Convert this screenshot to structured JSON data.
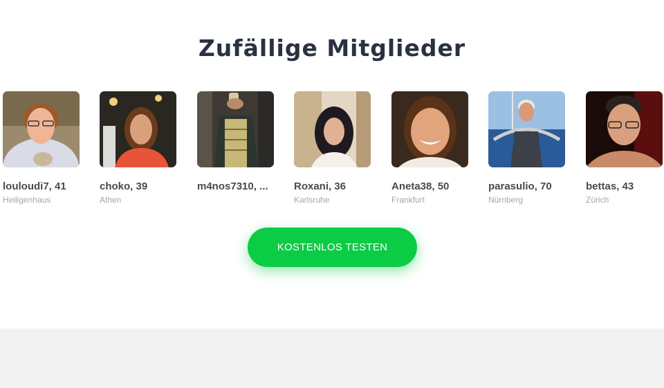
{
  "heading": "Zufällige Mitglieder",
  "members": [
    {
      "name": "louloudi7, 41",
      "city": "Heiligenhaus"
    },
    {
      "name": "choko, 39",
      "city": "Athen"
    },
    {
      "name": "m4nos7310, ...",
      "city": ""
    },
    {
      "name": "Roxani, 36",
      "city": "Karlsruhe"
    },
    {
      "name": "Aneta38, 50",
      "city": "Frankfurt"
    },
    {
      "name": "parasulio, 70",
      "city": "Nürnberg"
    },
    {
      "name": "bettas, 43",
      "city": "Zürich"
    }
  ],
  "cta_label": "KOSTENLOS TESTEN",
  "colors": {
    "cta": "#0ccb45",
    "heading": "#2a3140",
    "footer": "#f2f2f2"
  }
}
